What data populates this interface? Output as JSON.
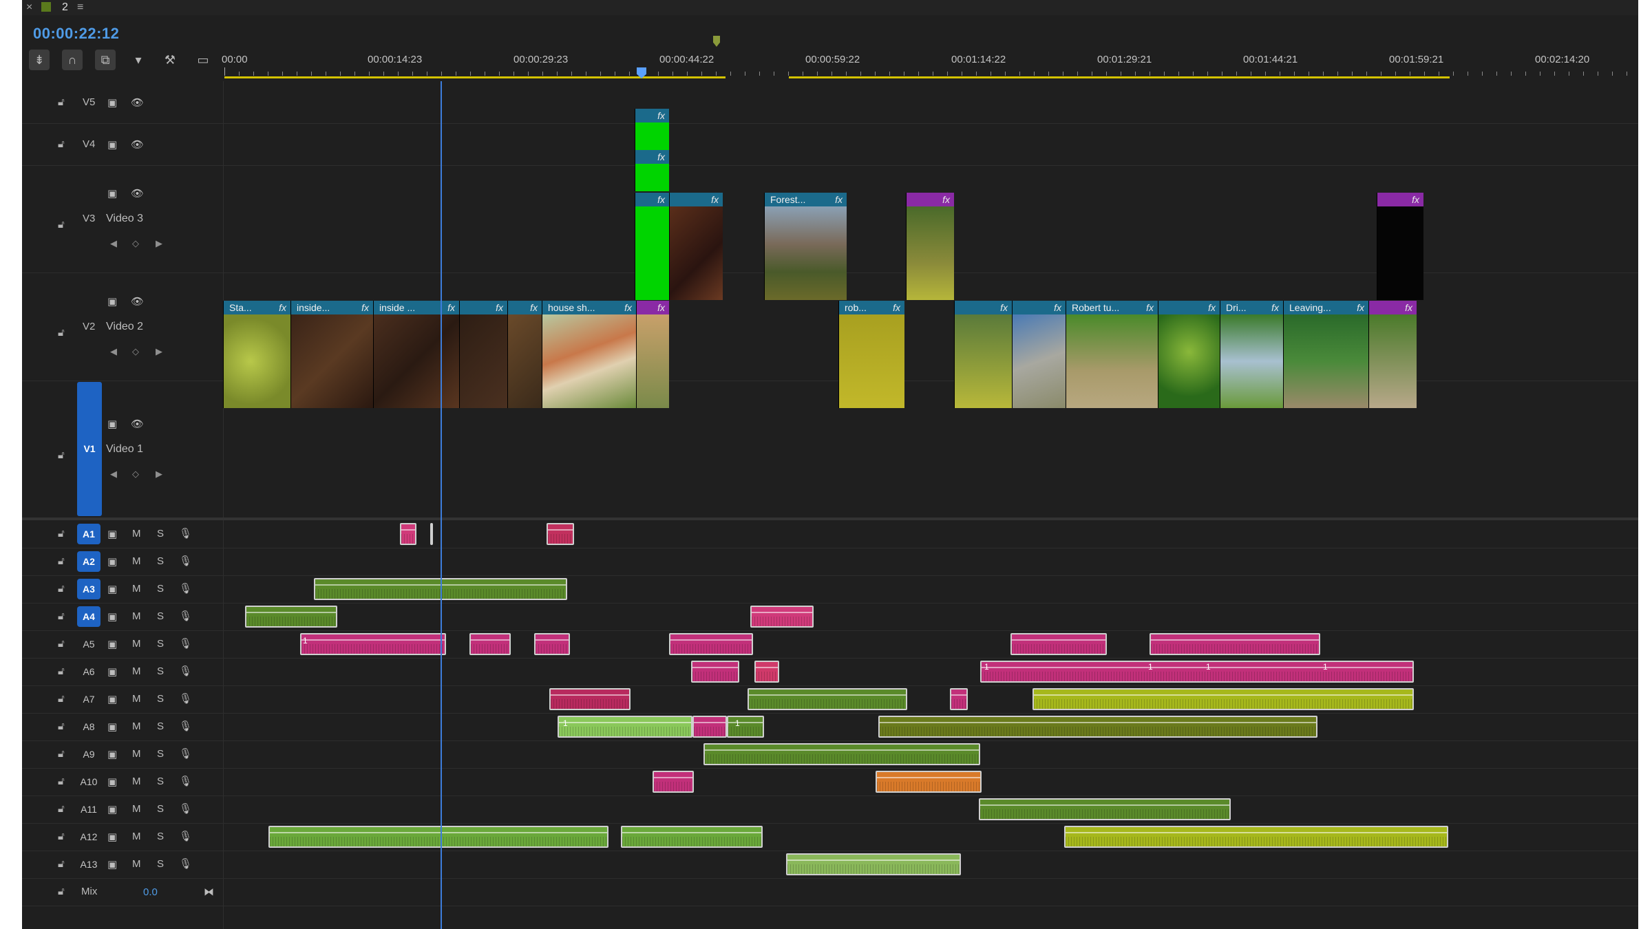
{
  "tabs": {
    "close_glyph": "×",
    "sequence_name": "2",
    "menu_glyph": "≡"
  },
  "timecode": "00:00:22:12",
  "tools": [
    "insert-overwrite-icon",
    "snap-icon",
    "linked-selection-icon",
    "add-marker-icon",
    "wrench-icon",
    "captions-icon"
  ],
  "ruler": {
    "labels": [
      "00:00",
      "00:00:14:23",
      "00:00:29:23",
      "00:00:44:22",
      "00:00:59:22",
      "00:01:14:22",
      "00:01:29:21",
      "00:01:44:21",
      "00:01:59:21",
      "00:02:14:20"
    ]
  },
  "video_tracks": [
    {
      "id": "V5",
      "name": ""
    },
    {
      "id": "V4",
      "name": ""
    },
    {
      "id": "V3",
      "name": "Video 3"
    },
    {
      "id": "V2",
      "name": "Video 2"
    },
    {
      "id": "V1",
      "name": "Video 1",
      "source_patched": true
    }
  ],
  "audio_tracks": [
    "A1",
    "A2",
    "A3",
    "A4",
    "A5",
    "A6",
    "A7",
    "A8",
    "A9",
    "A10",
    "A11",
    "A12",
    "A13"
  ],
  "audio_selected": [
    "A1",
    "A2",
    "A3",
    "A4"
  ],
  "audio_buttons": {
    "mute": "M",
    "solo": "S"
  },
  "mix": {
    "label": "Mix",
    "value": "0.0"
  },
  "clip_labels": {
    "fx": "fx",
    "v3_forest": "Forest...",
    "v2_sta": "Sta...",
    "v2_inside1": "inside...",
    "v2_inside2": "inside ...",
    "v2_house": "house sh...",
    "v2_rob": "rob...",
    "v2_robert": "Robert tu...",
    "v2_dri": "Dri...",
    "v2_leaving": "Leaving..."
  },
  "keyframe_badge": "1",
  "colors": {
    "accent_blue": "#1e63c3",
    "timecode_blue": "#4f9be6",
    "video_clip": "#1b6a8b",
    "adjust_clip": "#8a2aa5",
    "green_matte": "#00d400",
    "audio_green": "#5a8a2a",
    "audio_pink": "#c2307a",
    "audio_orange": "#d97a2a",
    "audio_yellowgreen": "#a6b81c",
    "workbar": "#d4c300"
  }
}
